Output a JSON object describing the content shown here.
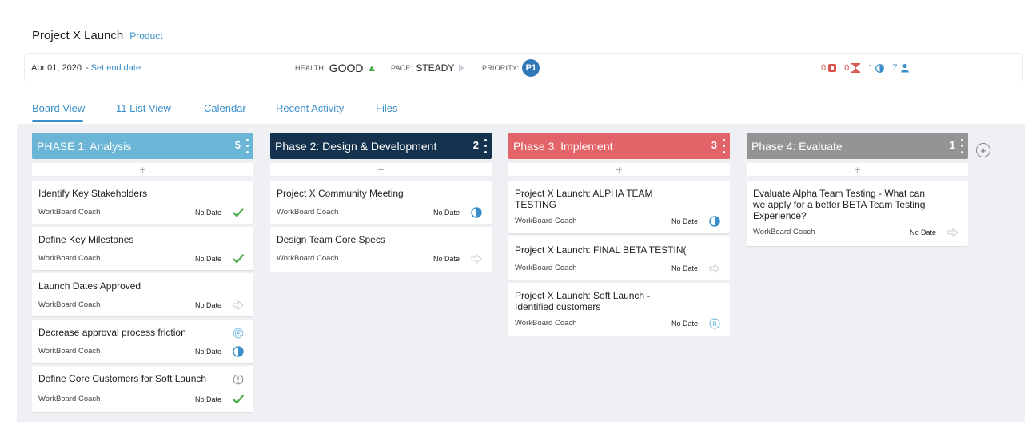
{
  "project": {
    "title": "Project X Launch",
    "category": "Product"
  },
  "info_bar": {
    "start_date": "Apr 01, 2020",
    "separator": "-",
    "set_end_date": "Set end date",
    "health_label": "HEALTH:",
    "health_value": "GOOD",
    "pace_label": "PACE:",
    "pace_value": "STEADY",
    "priority_label": "PRIORITY:",
    "priority_value": "P1",
    "counters": {
      "overdue": "0",
      "late": "0",
      "in_progress": "1",
      "members": "7"
    }
  },
  "tabs": [
    "Board View",
    "11 List View",
    "Calendar",
    "Recent Activity",
    "Files"
  ],
  "add_symbol": "+",
  "columns": [
    {
      "title": "PHASE 1: Analysis",
      "count": "5",
      "color": "#6bb6d6",
      "cards": [
        {
          "title": "Identify Key Stakeholders",
          "owner": "WorkBoard Coach",
          "date": "No Date",
          "status": "check-icon"
        },
        {
          "title": "Define Key Milestones",
          "owner": "WorkBoard Coach",
          "date": "No Date",
          "status": "check-icon"
        },
        {
          "title": "Launch Dates Approved",
          "owner": "WorkBoard Coach",
          "date": "No Date",
          "status": "arrow-right-icon"
        },
        {
          "title": "Decrease approval process friction",
          "owner": "WorkBoard Coach",
          "date": "No Date",
          "status": "half-circle-icon",
          "flag": "target-icon"
        },
        {
          "title": "Define Core Customers for Soft Launch",
          "owner": "WorkBoard Coach",
          "date": "No Date",
          "status": "check-icon",
          "flag": "alert-icon"
        }
      ]
    },
    {
      "title": "Phase 2: Design & Development",
      "count": "2",
      "color": "#14324d",
      "cards": [
        {
          "title": "Project X Community Meeting",
          "owner": "WorkBoard Coach",
          "date": "No Date",
          "status": "half-circle-icon"
        },
        {
          "title": "Design Team Core Specs",
          "owner": "WorkBoard Coach",
          "date": "No Date",
          "status": "arrow-right-icon"
        }
      ]
    },
    {
      "title": "Phase 3: Implement",
      "count": "3",
      "color": "#e26468",
      "cards": [
        {
          "title": "Project X Launch: ALPHA TEAM TESTING",
          "owner": "WorkBoard Coach",
          "date": "No Date",
          "status": "half-circle-icon"
        },
        {
          "title": "Project X Launch: FINAL BETA TESTIN(",
          "owner": "WorkBoard Coach",
          "date": "No Date",
          "status": "arrow-right-icon"
        },
        {
          "title": "Project X Launch: Soft Launch - Identified customers",
          "owner": "WorkBoard Coach",
          "date": "No Date",
          "status": "pause-icon"
        }
      ]
    },
    {
      "title": "Phase 4: Evaluate",
      "count": "1",
      "color": "#949494",
      "cards": [
        {
          "title": "Evaluate Alpha Team Testing - What can we apply for a better BETA Team Testing Experience?",
          "owner": "WorkBoard Coach",
          "date": "No Date",
          "status": "arrow-right-icon"
        }
      ]
    }
  ],
  "colors": {
    "accent": "#3a8fc9",
    "green": "#4cae4c",
    "red": "#d9534f",
    "board_bg": "#eef0f3"
  }
}
